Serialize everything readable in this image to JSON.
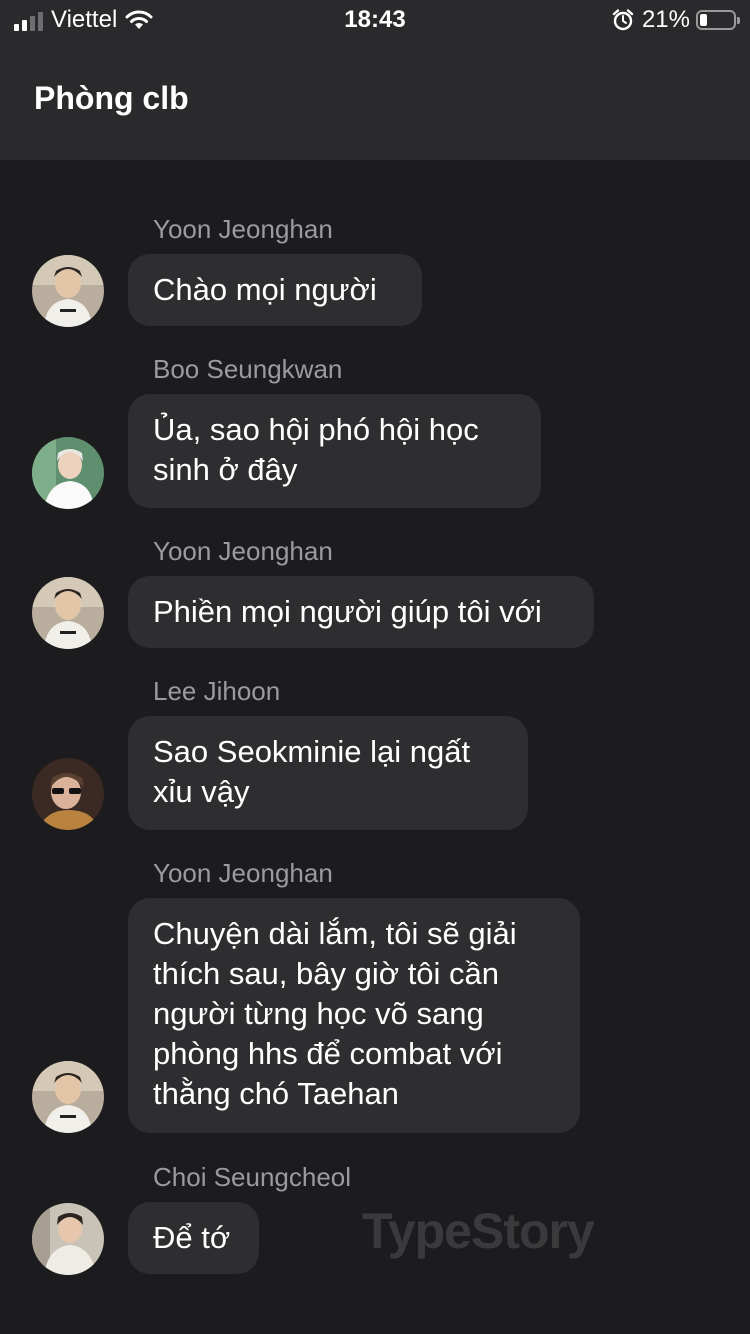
{
  "status_bar": {
    "carrier": "Viettel",
    "time": "18:43",
    "battery_percent": "21%",
    "battery_level": 0.21,
    "signal_bars": 2,
    "icons": [
      "signal-icon",
      "wifi-icon",
      "alarm-icon",
      "battery-icon"
    ]
  },
  "header": {
    "title": "Phòng clb"
  },
  "messages": [
    {
      "sender": "Yoon Jeonghan",
      "text": "Chào mọi người",
      "avatar": "avatar-jeonghan"
    },
    {
      "sender": "Boo Seungkwan",
      "text": "Ủa, sao hội phó hội học sinh ở đây",
      "avatar": "avatar-seungkwan"
    },
    {
      "sender": "Yoon Jeonghan",
      "text": "Phiền mọi người giúp tôi với",
      "avatar": "avatar-jeonghan"
    },
    {
      "sender": "Lee Jihoon",
      "text": "Sao Seokminie lại ngất xỉu vậy",
      "avatar": "avatar-jihoon"
    },
    {
      "sender": "Yoon Jeonghan",
      "text": "Chuyện dài lắm, tôi sẽ giải thích sau, bây giờ tôi cần người từng học võ sang phòng hhs để combat với thằng chó Taehan",
      "avatar": "avatar-jeonghan"
    },
    {
      "sender": "Choi Seungcheol",
      "text": "Để tớ",
      "avatar": "avatar-seungcheol"
    }
  ],
  "watermark": "TypeStory",
  "colors": {
    "background": "#1c1c1e",
    "header_bg": "#2a2a2c",
    "bubble_bg": "#2e2e31",
    "sender_text": "#9a9aa0"
  }
}
